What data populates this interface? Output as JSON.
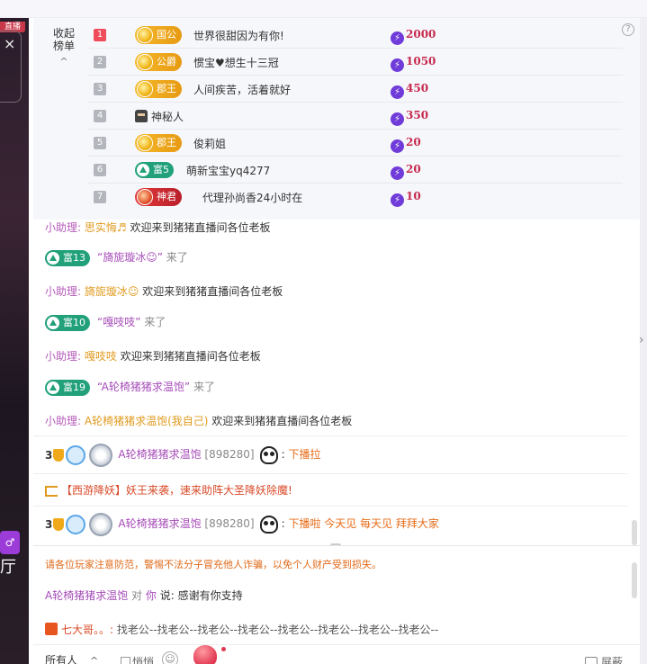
{
  "left_video": {
    "badge": "直播",
    "close_symbol": "×",
    "purple_symbol": "♂",
    "bottom_text": "厅"
  },
  "rank": {
    "toggle_label_1": "收起",
    "toggle_label_2": "榜单",
    "toggle_chevron": "^",
    "help_symbol": "?",
    "rows": [
      {
        "rank": "1",
        "badge": "国公",
        "badge_type": "gold",
        "name": "世界很甜因为有你!",
        "score": "2000"
      },
      {
        "rank": "2",
        "badge": "公爵",
        "badge_type": "gold",
        "name": "惯宝♥想生十三冠",
        "score": "1050"
      },
      {
        "rank": "3",
        "badge": "郡王",
        "badge_type": "gold",
        "name": "人间疾苦，活着就好",
        "score": "450"
      },
      {
        "rank": "4",
        "badge": "",
        "badge_type": "ninja",
        "name": "神秘人",
        "score": "350"
      },
      {
        "rank": "5",
        "badge": "郡王",
        "badge_type": "gold",
        "name": "俊莉姐",
        "score": "20"
      },
      {
        "rank": "6",
        "badge": "富5",
        "badge_type": "fu",
        "name": "萌新宝宝yq4277",
        "score": "20"
      },
      {
        "rank": "7",
        "badge": "神君",
        "badge_type": "red",
        "name": "代理孙尚香24小时在",
        "score": "10"
      }
    ]
  },
  "chat": {
    "assistant_label": "小助理:",
    "welcome_text": "欢迎来到猪猪直播间各位老板",
    "came_text": "来了",
    "rows": [
      {
        "type": "assist",
        "user": "思实悔♬"
      },
      {
        "type": "enter",
        "badge": "富13",
        "user": "“旖旎璇冰☺”"
      },
      {
        "type": "assist",
        "user": "旖旎璇冰☺"
      },
      {
        "type": "enter",
        "badge": "富10",
        "user": "“嘎吱吱”"
      },
      {
        "type": "assist",
        "user": "嘎吱吱"
      },
      {
        "type": "enter",
        "badge": "富19",
        "user": "“A轮椅猪猪求温饱”"
      },
      {
        "type": "assist",
        "user": "A轮椅猪猪求温饱(我自己)"
      }
    ],
    "msg1": {
      "level": "3",
      "user": "A轮椅猪猪求温饱",
      "id": "[898280]",
      "colon": ":",
      "text": "下播拉"
    },
    "system": {
      "tag": "【西游降妖】",
      "text": "妖王来袭，速来助阵大圣降妖除魔!"
    },
    "msg2": {
      "level": "3",
      "user": "A轮椅猪猪求温饱",
      "id": "[898280]",
      "colon": ":",
      "text": "下播啦 今天见 每天见 拜拜大家"
    }
  },
  "notice": {
    "warning": "请各位玩家注意防范，警惕不法分子冒充他人诈骗，以免个人财产受到损失。",
    "private_user": "A轮椅猪猪求温饱",
    "private_to": "对",
    "private_you": "你",
    "private_say": "说:",
    "private_text": "感谢有你支持",
    "broadcast_user": "七大哥。。:",
    "broadcast_text": "找老公--找老公--找老公--找老公--找老公--找老公--找老公--找老公--"
  },
  "bottom": {
    "select_value": "所有人",
    "select_chevron": "^",
    "quiet_label": "悄悄",
    "emoji_symbol": "☺",
    "block_label": "屏蔽"
  },
  "right_arrow": "›"
}
